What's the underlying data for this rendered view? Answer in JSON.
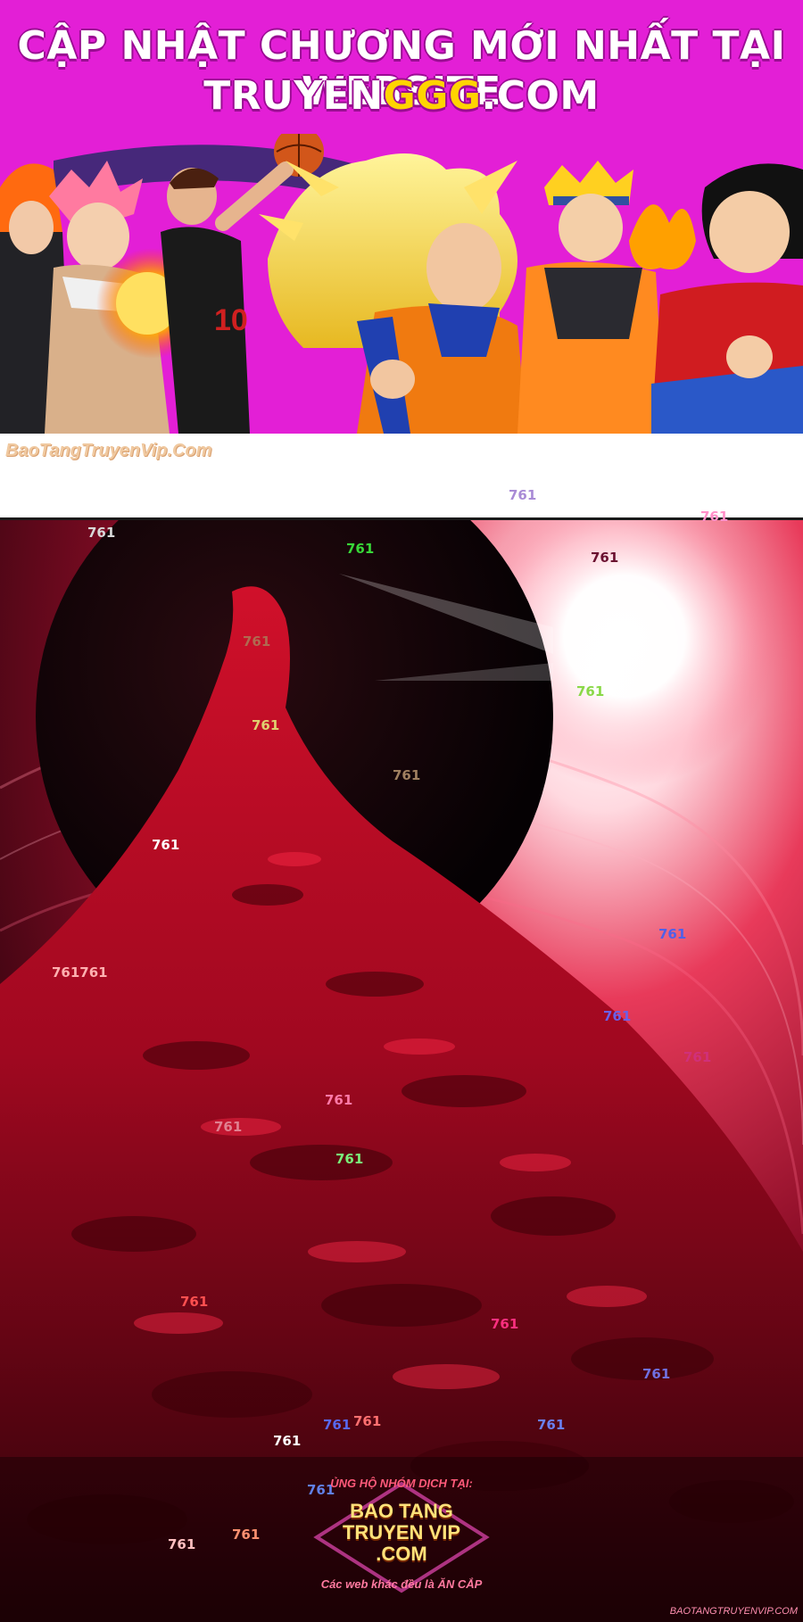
{
  "banner": {
    "line1": "CẬP NHẬT CHƯƠNG MỚI NHẤT TẠI WEBSITE",
    "line2_prefix": "TRUYEN",
    "line2_highlight": "GGG",
    "line2_suffix": ".COM",
    "background": "#e31fd6",
    "highlight_color": "#ffd400"
  },
  "strip": {
    "watermark": "BaoTangTruyenVip.Com"
  },
  "overlay_numbers": [
    {
      "text": "761",
      "color": "#a98bd6"
    },
    {
      "text": "761",
      "color": "#ff8fc8"
    },
    {
      "text": "761",
      "color": "#d8d8d8"
    },
    {
      "text": "761",
      "color": "#38d838"
    },
    {
      "text": "761",
      "color": "#6a1030"
    },
    {
      "text": "761",
      "color": "#b06a50"
    },
    {
      "text": "761",
      "color": "#8ad848"
    },
    {
      "text": "761",
      "color": "#e0d070"
    },
    {
      "text": "761",
      "color": "#a08060"
    },
    {
      "text": "761",
      "color": "#ffffff"
    },
    {
      "text": "761",
      "color": "#5060e8"
    },
    {
      "text": "761761",
      "color": "#ffb0b0"
    },
    {
      "text": "761",
      "color": "#6a60e8"
    },
    {
      "text": "761",
      "color": "#d0307a"
    },
    {
      "text": "761",
      "color": "#ff7aa8"
    },
    {
      "text": "761",
      "color": "#e08090"
    },
    {
      "text": "761",
      "color": "#7af07a"
    },
    {
      "text": "761",
      "color": "#ff5050"
    },
    {
      "text": "761",
      "color": "#ff3080"
    },
    {
      "text": "761",
      "color": "#7070e0"
    },
    {
      "text": "761",
      "color": "#5868f0"
    },
    {
      "text": "761",
      "color": "#ff7070"
    },
    {
      "text": "761",
      "color": "#ffffff"
    },
    {
      "text": "761",
      "color": "#6a80f0"
    },
    {
      "text": "761",
      "color": "#6080e8"
    },
    {
      "text": "761",
      "color": "#ff9070"
    },
    {
      "text": "761",
      "color": "#ffc0c0"
    }
  ],
  "credit": {
    "top": "ỦNG HỘ NHÓM DỊCH TẠI:",
    "name1": "BAO TANG",
    "name2": "TRUYEN VIP",
    "name3": ".COM",
    "bottom": "Các web khác đều là ĂN CẮP"
  },
  "corner_mark": "BAOTANGTRUYENVIP.COM"
}
